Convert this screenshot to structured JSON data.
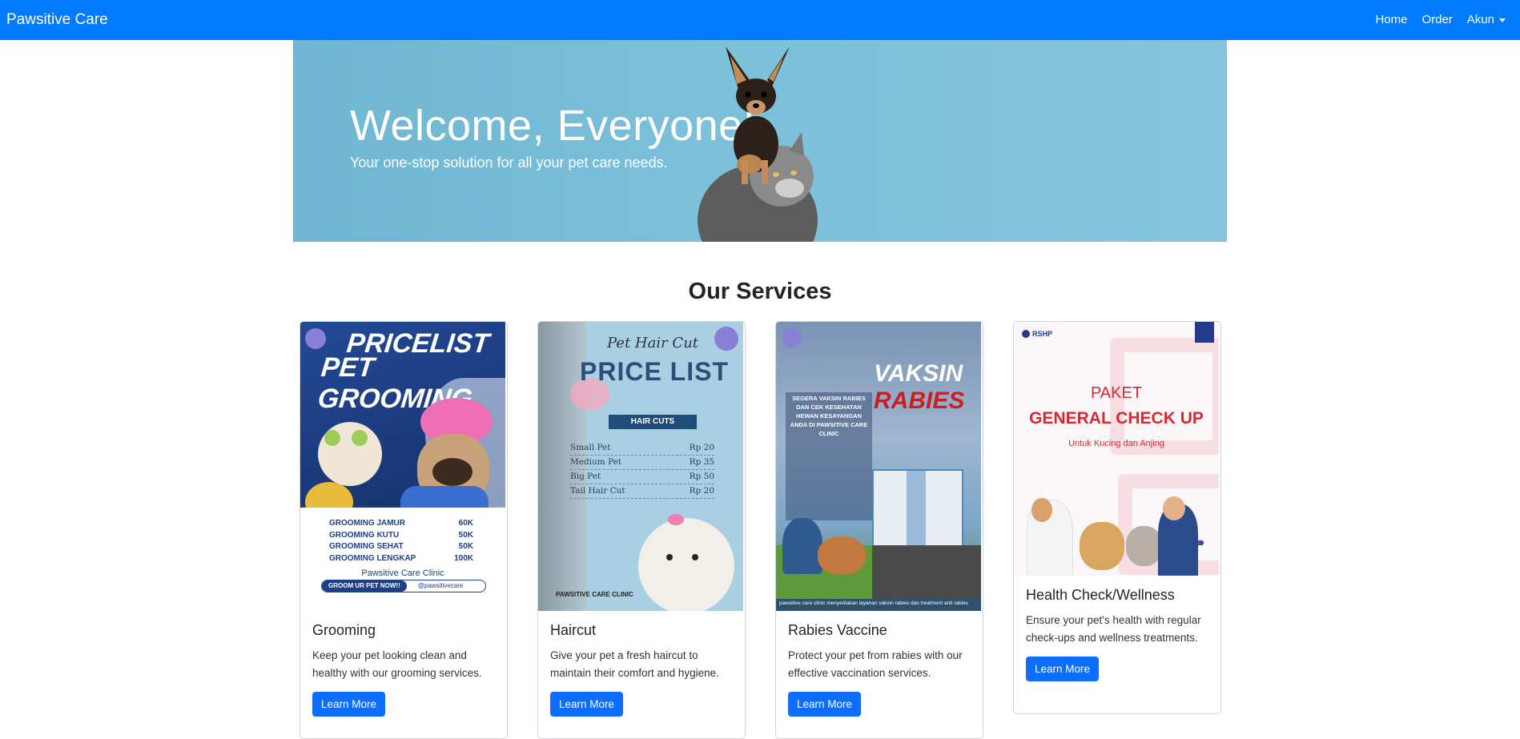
{
  "nav": {
    "brand": "Pawsitive Care",
    "links": [
      "Home",
      "Order",
      "Akun"
    ]
  },
  "hero": {
    "title": "Welcome, Everyone!",
    "subtitle": "Your one-stop solution for all your pet care needs."
  },
  "services": {
    "heading": "Our Services",
    "cards": [
      {
        "title": "Grooming",
        "text": "Keep your pet looking clean and healthy with our grooming services.",
        "button": "Learn More",
        "poster": {
          "headline1": "PRICELIST",
          "headline2": "PET GROOMING",
          "items": [
            {
              "name": "GROOMING JAMUR",
              "price": "60K"
            },
            {
              "name": "GROOMING KUTU",
              "price": "50K"
            },
            {
              "name": "GROOMING SEHAT",
              "price": "50K"
            },
            {
              "name": "GROOMING LENGKAP",
              "price": "100K"
            }
          ],
          "clinic": "Pawsitive Care Clinic",
          "cta": "GROOM UR PET NOW!!",
          "handle": "@pawsitivecare"
        }
      },
      {
        "title": "Haircut",
        "text": "Give your pet a fresh haircut to maintain their comfort and hygiene.",
        "button": "Learn More",
        "poster": {
          "script": "Pet Hair Cut",
          "headline": "PRICE LIST",
          "ribbon": "HAIR CUTS",
          "items": [
            {
              "name": "Small Pet",
              "price": "Rp 20"
            },
            {
              "name": "Medium Pet",
              "price": "Rp 35"
            },
            {
              "name": "Big Pet",
              "price": "Rp 50"
            },
            {
              "name": "Tail Hair Cut",
              "price": "Rp 20"
            }
          ],
          "clinic": "PAWSITIVE CARE CLINIC"
        }
      },
      {
        "title": "Rabies Vaccine",
        "text": "Protect your pet from rabies with our effective vaccination services.",
        "button": "Learn More",
        "poster": {
          "headline1": "VAKSIN",
          "headline2": "RABIES",
          "lead": "SEGERA VAKSIN RABIES DAN CEK KESEHATAN HEWAN KESAYANGAN ANDA DI PAWSITIVE CARE CLINIC",
          "footer": "pawsitive care clinic menyediakan layanan vaksin rabies dan treatment anti rabies"
        }
      },
      {
        "title": "Health Check/Wellness",
        "text": "Ensure your pet's health with regular check-ups and wellness treatments.",
        "button": "Learn More",
        "poster": {
          "logo": "RSHP",
          "headline1": "PAKET",
          "headline2": "GENERAL CHECK UP",
          "sub": "Untuk Kucing dan Anjing"
        }
      }
    ]
  },
  "colors": {
    "navbar": "#007bff",
    "button": "#0d6efd",
    "hero_bg": "#7cc0da"
  }
}
